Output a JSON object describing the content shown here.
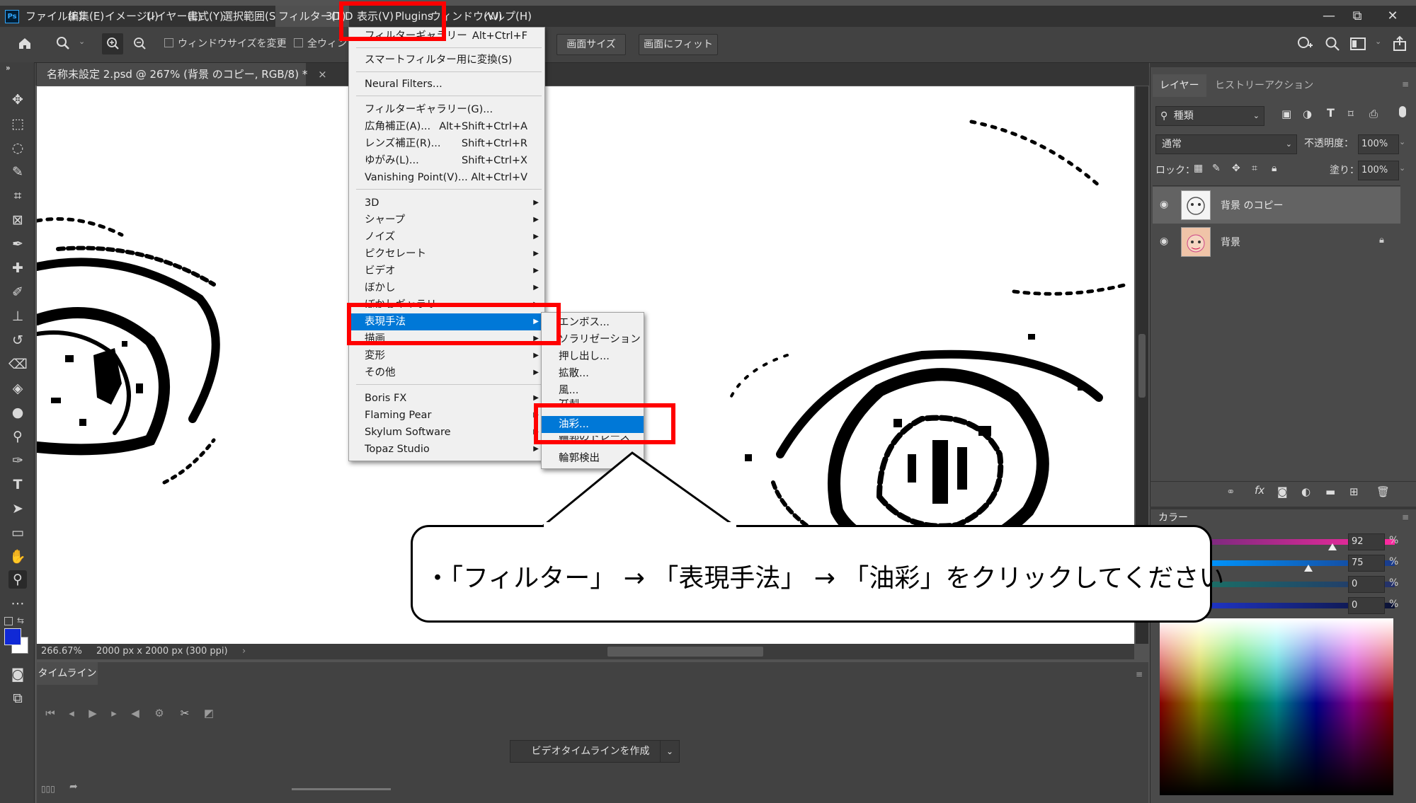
{
  "menubar": {
    "items": [
      "ファイル(F)",
      "編集(E)",
      "イメージ(I)",
      "レイヤー(L)",
      "書式(Y)",
      "選択範囲(S",
      "フィルター(T)",
      "3D(D",
      "表示(V)",
      "Plugins",
      "ウィンドウ(W)",
      "ヘルプ(H)"
    ],
    "logo": "Ps"
  },
  "window_controls": [
    "—",
    "⧉",
    "✕"
  ],
  "options_bar": {
    "checkbox_resize": "ウィンドウサイズを変更",
    "checkbox_all": "全ウィン",
    "btn_screen_size": "画面サイズ",
    "btn_fit_screen": "画面にフィット"
  },
  "document": {
    "tab_title": "名称未設定 2.psd @ 267% (背景 のコピー, RGB/8) *",
    "tab_close": "×",
    "zoom": "266.67%",
    "size_info": "2000 px x 2000 px (300 ppi)"
  },
  "filter_menu": {
    "top_label": "フィルターギャラリー",
    "top_shortcut": "Alt+Ctrl+F",
    "smart": "スマートフィルター用に変換(S)",
    "neural": "Neural Filters...",
    "items_a": [
      {
        "label": "フィルターギャラリー(G)...",
        "shortcut": ""
      },
      {
        "label": "広角補正(A)...",
        "shortcut": "Alt+Shift+Ctrl+A"
      },
      {
        "label": "レンズ補正(R)...",
        "shortcut": "Shift+Ctrl+R"
      },
      {
        "label": "ゆがみ(L)...",
        "shortcut": "Shift+Ctrl+X"
      },
      {
        "label": "Vanishing Point(V)...",
        "shortcut": "Alt+Ctrl+V"
      }
    ],
    "items_b": [
      "3D",
      "シャープ",
      "ノイズ",
      "ピクセレート",
      "ビデオ",
      "ぼかし",
      "ぼかしギャラリ",
      "表現手法",
      "描画",
      "変形",
      "その他"
    ],
    "items_c": [
      "Boris FX",
      "Flaming Pear",
      "Skylum Software",
      "Topaz Studio"
    ]
  },
  "submenu": {
    "items": [
      "エンボス...",
      "ソラリゼーション",
      "押し出し...",
      "拡散...",
      "風...",
      "分割",
      "油彩...",
      "輪郭のトレース",
      "輪郭検出"
    ]
  },
  "callout": {
    "text": "・「フィルター」 → 「表現手法」 → 「油彩」をクリックしてください"
  },
  "panels": {
    "tabs": [
      "レイヤー",
      "ヒストリー",
      "アクション"
    ],
    "kind_label": "種類",
    "blend_mode": "通常",
    "opacity_label": "不透明度：",
    "opacity_value": "100%",
    "lock_label": "ロック：",
    "fill_label": "塗り：",
    "fill_value": "100%",
    "layers": [
      {
        "name": "背景 のコピー",
        "selected": true
      },
      {
        "name": "背景",
        "selected": false
      }
    ],
    "color_tab": "カラー",
    "color_values": [
      "92",
      "75",
      "0",
      "0"
    ],
    "percent": "%"
  },
  "timeline": {
    "tab": "タイムライン",
    "create_button": "ビデオタイムラインを作成"
  },
  "colors": {
    "highlight": "#0078d7",
    "red_box": "#ff0000",
    "foreground": "#1029d6"
  }
}
